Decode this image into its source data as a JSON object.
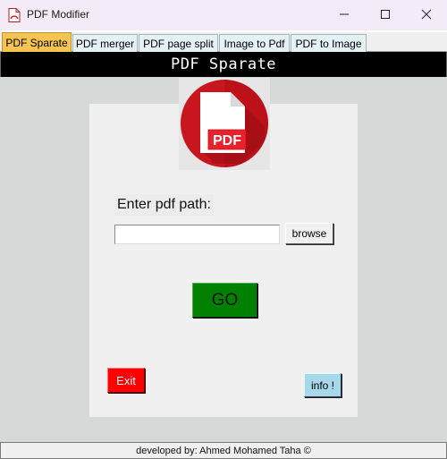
{
  "window": {
    "title": "PDF Modifier",
    "icon": "pdf-app-icon"
  },
  "tabs": [
    {
      "label": "PDF Sparate",
      "active": true
    },
    {
      "label": "PDF merger",
      "active": false
    },
    {
      "label": "PDF page split",
      "active": false
    },
    {
      "label": "Image to Pdf",
      "active": false
    },
    {
      "label": "PDF to Image",
      "active": false
    }
  ],
  "header": {
    "title": "PDF Sparate"
  },
  "logo": {
    "label": "PDF",
    "icon": "pdf-file-icon",
    "colors": {
      "circle": "#c9151e",
      "badge": "#e8212b",
      "page": "#ffffff"
    }
  },
  "form": {
    "path_label": "Enter pdf path:",
    "path_value": "",
    "browse_label": "browse",
    "go_label": "GO"
  },
  "actions": {
    "exit_label": "Exit",
    "info_label": "info !"
  },
  "footer": {
    "credit": "developed by: Ahmed Mohamed Taha ©"
  },
  "colors": {
    "active_tab": "#f5c451",
    "go": "#028002",
    "exit": "#ff0000",
    "info": "#a7d8e9"
  }
}
